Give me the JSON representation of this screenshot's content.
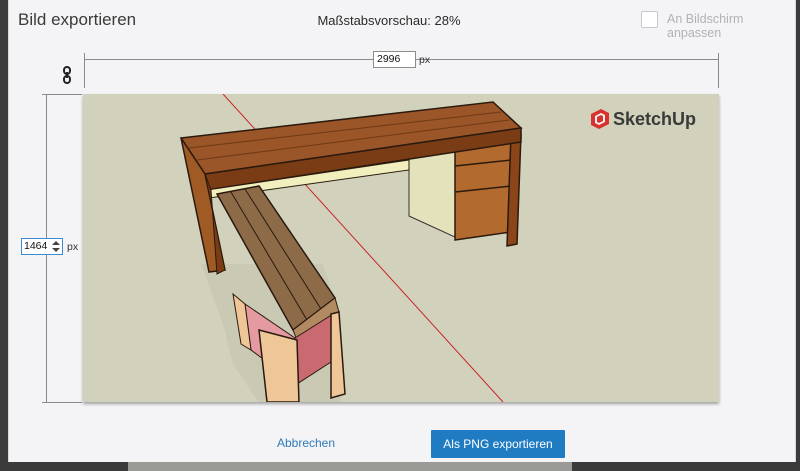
{
  "dialog": {
    "title": "Bild exportieren",
    "scale_preview": "Maßstabsvorschau: 28%",
    "fit_to_screen_label": "An Bildschirm anpassen",
    "fit_to_screen_checked": false
  },
  "dimensions": {
    "width_value": "2996",
    "height_value": "1464",
    "unit": "px",
    "lock_icon": "chain-link-icon"
  },
  "preview": {
    "logo_text": "SketchUp",
    "logo_color": "#d8312e",
    "background_color": "#d2d2bc"
  },
  "buttons": {
    "cancel_label": "Abbrechen",
    "export_label": "Als PNG exportieren",
    "accent": "#1f7bc2"
  }
}
